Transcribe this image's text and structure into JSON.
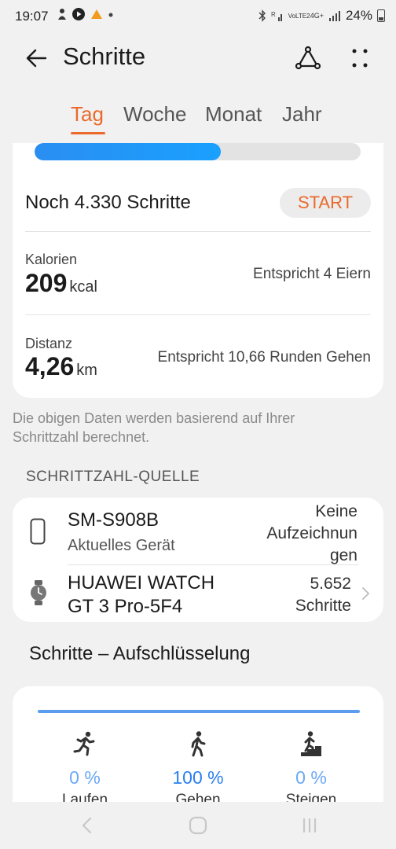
{
  "status_bar": {
    "time": "19:07",
    "battery": "24%",
    "network": "4G+",
    "volte": "VoLTE2"
  },
  "app_bar": {
    "title": "Schritte"
  },
  "tabs": [
    {
      "label": "Tag",
      "active": true
    },
    {
      "label": "Woche",
      "active": false
    },
    {
      "label": "Monat",
      "active": false
    },
    {
      "label": "Jahr",
      "active": false
    }
  ],
  "goal": {
    "progress_fraction": 0.57,
    "remaining_text": "Noch 4.330 Schritte",
    "start_label": "START"
  },
  "calories": {
    "label": "Kalorien",
    "value": "209",
    "unit": "kcal",
    "note": "Entspricht 4 Eiern"
  },
  "distance": {
    "label": "Distanz",
    "value": "4,26",
    "unit": "km",
    "note": "Entspricht 10,66 Runden Gehen"
  },
  "footnote": "Die obigen Daten werden basierend auf Ihrer Schrittzahl berechnet.",
  "source_section": {
    "header": "SCHRITTZAHL-QUELLE",
    "sources": [
      {
        "name": "SM-S908B",
        "sub": "Aktuelles Gerät",
        "status_lines": [
          "Keine",
          "Aufzeichnun",
          "gen"
        ],
        "icon": "phone-icon"
      },
      {
        "name_lines": [
          "HUAWEI WATCH",
          "GT 3 Pro-5F4"
        ],
        "status_lines": [
          "5.652",
          "Schritte"
        ],
        "icon": "watch-icon"
      }
    ]
  },
  "breakdown": {
    "title": "Schritte – Aufschlüsselung",
    "bar_fill_fraction": 1.0,
    "items": [
      {
        "percent": "0 %",
        "label": "Laufen",
        "icon": "running-icon"
      },
      {
        "percent": "100 %",
        "label": "Gehen",
        "icon": "walking-icon"
      },
      {
        "percent": "0 %",
        "label": "Steigen",
        "icon": "climbing-icon"
      }
    ]
  },
  "colors": {
    "accent": "#ea6a2b",
    "progress": "#2a8ef1",
    "percent": "#2a7ff0",
    "background": "#f1f1f1",
    "card": "#ffffff"
  }
}
